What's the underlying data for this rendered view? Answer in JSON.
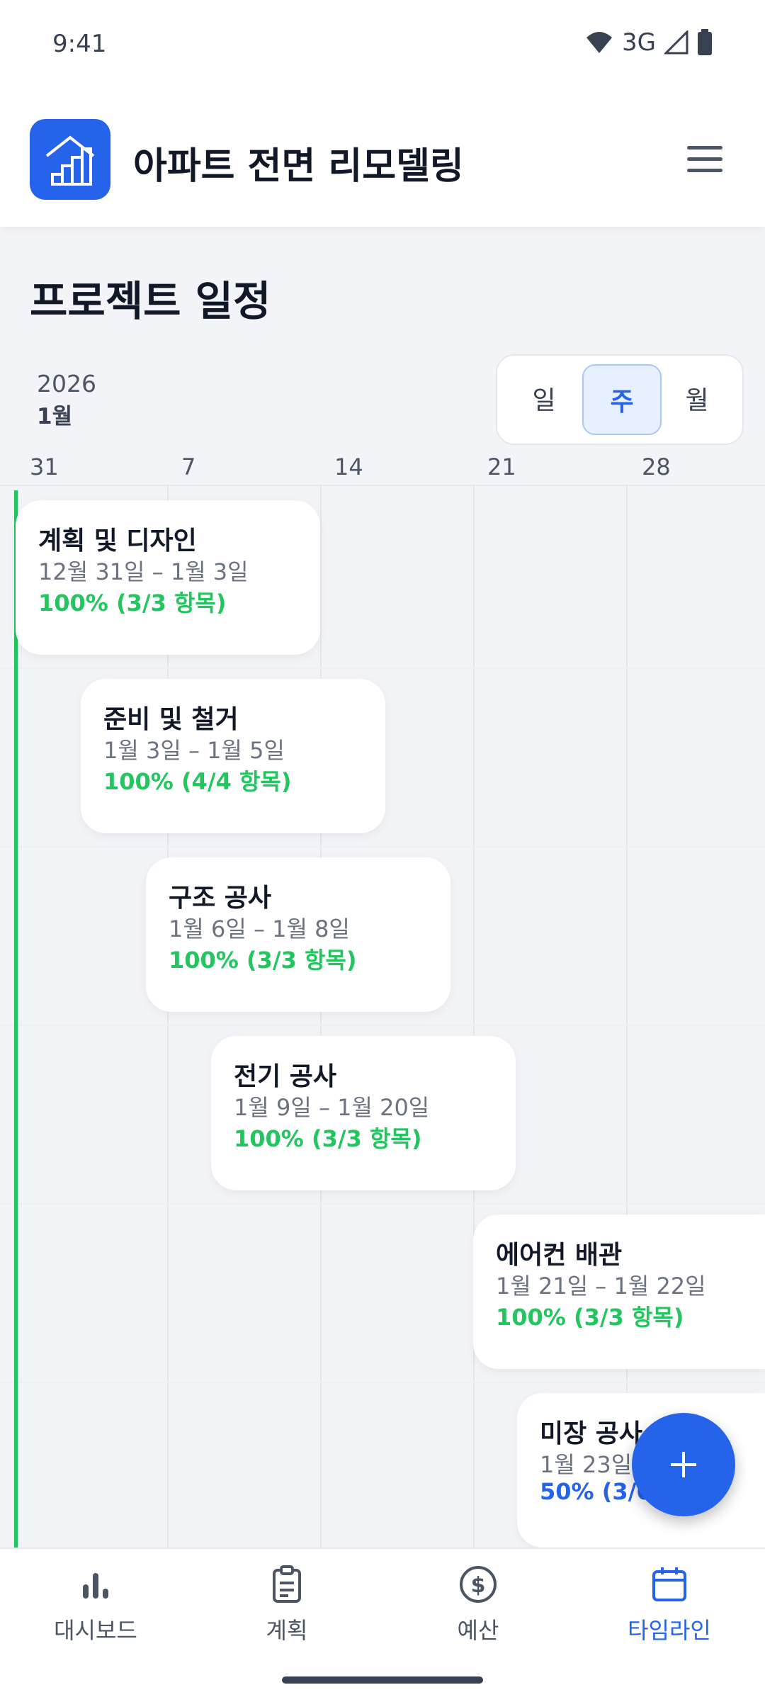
{
  "status_bar": {
    "time": "9:41",
    "network": "3G"
  },
  "app_bar": {
    "title": "아파트 전면 리모델링"
  },
  "page": {
    "title": "프로젝트 일정",
    "year": "2026",
    "month": "1월"
  },
  "view_toggle": {
    "options": [
      "일",
      "주",
      "월"
    ],
    "selected": "주"
  },
  "day_ticks": [
    "31",
    "7",
    "14",
    "21",
    "28"
  ],
  "tasks": [
    {
      "title": "계획 및 디자인",
      "dates": "12월 31일 – 1월 3일",
      "progress": "100% (3/3 항목)",
      "status": "done"
    },
    {
      "title": "준비 및 철거",
      "dates": "1월 3일 – 1월 5일",
      "progress": "100% (4/4 항목)",
      "status": "done"
    },
    {
      "title": "구조 공사",
      "dates": "1월 6일 – 1월 8일",
      "progress": "100% (3/3 항목)",
      "status": "done"
    },
    {
      "title": "전기 공사",
      "dates": "1월 9일 – 1월 20일",
      "progress": "100% (3/3 항목)",
      "status": "done"
    },
    {
      "title": "에어컨 배관",
      "dates": "1월 21일 – 1월 22일",
      "progress": "100% (3/3 항목)",
      "status": "done"
    },
    {
      "title": "미장 공사",
      "dates": "1월 23일 –",
      "progress": "50% (3/6",
      "status": "partial"
    }
  ],
  "colors": {
    "accent": "#2563eb",
    "done": "#22c55e",
    "today_line": "#22c55e"
  },
  "bottom_nav": [
    {
      "label": "대시보드",
      "icon": "bar-chart-icon",
      "active": false
    },
    {
      "label": "계획",
      "icon": "clipboard-icon",
      "active": false
    },
    {
      "label": "예산",
      "icon": "dollar-circle-icon",
      "active": false
    },
    {
      "label": "타임라인",
      "icon": "calendar-icon",
      "active": true
    }
  ]
}
